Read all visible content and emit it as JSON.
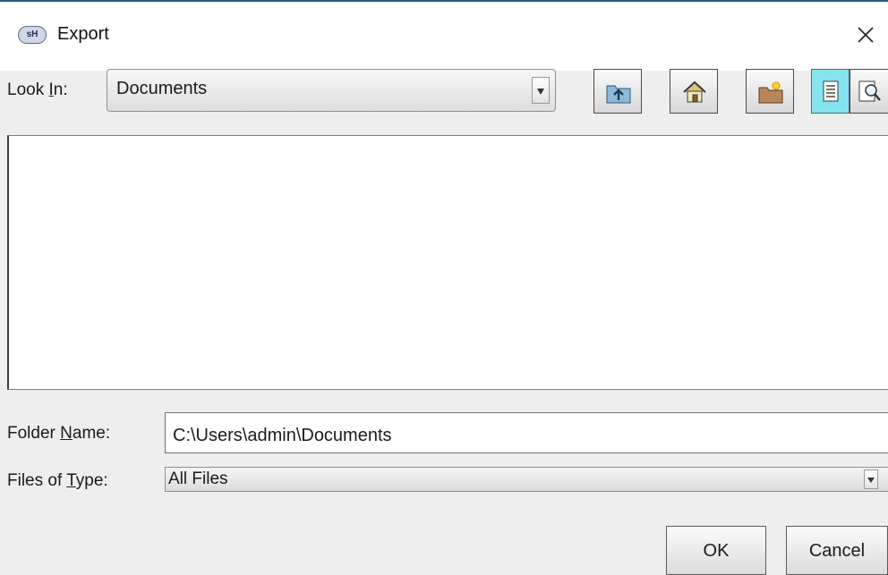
{
  "window": {
    "title": "Export",
    "app_icon_text": "sH"
  },
  "look_in": {
    "label_before": "Look ",
    "label_mnemonic": "I",
    "label_after": "n:",
    "value": "Documents"
  },
  "toolbar": {
    "icons": [
      "up-folder-icon",
      "home-icon",
      "new-folder-icon",
      "list-view-icon",
      "details-view-icon"
    ]
  },
  "folder_name": {
    "label_before": "Folder ",
    "label_mnemonic": "N",
    "label_after": "ame:",
    "value": "C:\\Users\\admin\\Documents"
  },
  "files_of_type": {
    "label_before": "Files of ",
    "label_mnemonic": "T",
    "label_after": "ype:",
    "value": "All Files"
  },
  "buttons": {
    "ok": "OK",
    "cancel": "Cancel"
  },
  "colors": {
    "active_toggle": "#85e4ef",
    "title_accent": "#1e5f8f"
  }
}
